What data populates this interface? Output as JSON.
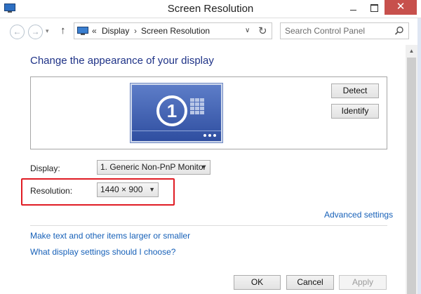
{
  "window": {
    "title": "Screen Resolution",
    "close_glyph": "✕"
  },
  "nav": {
    "back_glyph": "←",
    "forward_glyph": "→",
    "recent_glyph": "▾",
    "up_glyph": "↑",
    "address": {
      "chevrons": "«",
      "segments": [
        "Display",
        "Screen Resolution"
      ],
      "separator": "›",
      "dropdown_glyph": "∨",
      "refresh_glyph": "↻"
    },
    "search": {
      "placeholder": "Search Control Panel"
    }
  },
  "main": {
    "heading": "Change the appearance of your display",
    "monitor_number": "1",
    "buttons": {
      "detect": "Detect",
      "identify": "Identify"
    },
    "display": {
      "label": "Display:",
      "value": "1. Generic Non-PnP Monitor"
    },
    "resolution": {
      "label": "Resolution:",
      "value": "1440 × 900"
    },
    "select_arrow": "▼",
    "links": {
      "advanced": "Advanced settings",
      "larger": "Make text and other items larger or smaller",
      "which": "What display settings should I choose?"
    }
  },
  "footer": {
    "ok": "OK",
    "cancel": "Cancel",
    "apply": "Apply",
    "apply_enabled": false
  },
  "scrollbar": {
    "up_glyph": "▲"
  },
  "colors": {
    "heading": "#1e3287",
    "link": "#1660b8",
    "highlight": "#e01c24",
    "close_button": "#c7504c"
  }
}
